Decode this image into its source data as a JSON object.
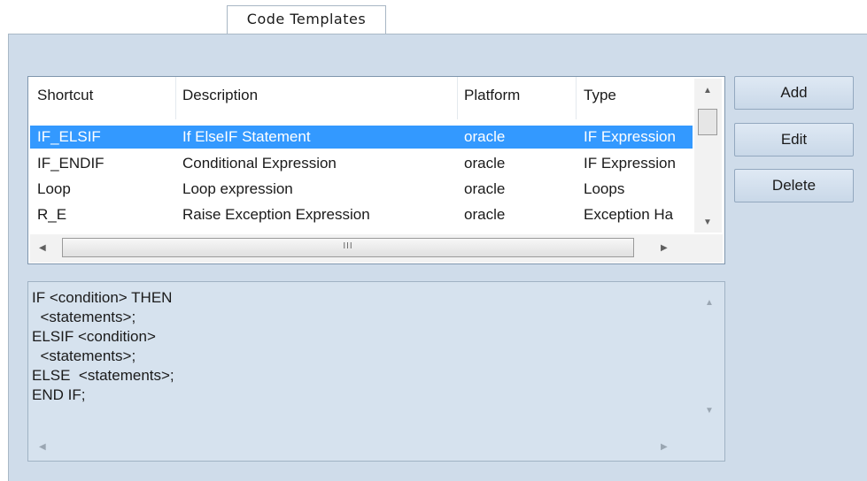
{
  "tab": {
    "label": "Code Templates"
  },
  "grid": {
    "columns": [
      "Shortcut",
      "Description",
      "Platform",
      "Type"
    ],
    "rows": [
      [
        "IF_ELSIF",
        "If ElseIF Statement",
        "oracle",
        "IF Expression"
      ],
      [
        "IF_ENDIF",
        "Conditional Expression",
        "oracle",
        "IF Expression"
      ],
      [
        "Loop",
        "Loop expression",
        "oracle",
        "Loops"
      ],
      [
        "R_E",
        "Raise Exception Expression",
        "oracle",
        "Exception Ha"
      ]
    ],
    "selected_index": 0,
    "grip": "III"
  },
  "preview": {
    "lines": [
      "IF <condition> THEN",
      "  <statements>;",
      "ELSIF <condition>",
      "  <statements>;",
      "ELSE  <statements>;",
      "END IF;"
    ]
  },
  "buttons": {
    "add": "Add",
    "edit": "Edit",
    "delete": "Delete"
  },
  "colors": {
    "selection": "#3399ff",
    "panel": "#cfdcea"
  },
  "icons": {
    "up": "▲",
    "down": "▼",
    "left": "◀",
    "right": "▶"
  }
}
